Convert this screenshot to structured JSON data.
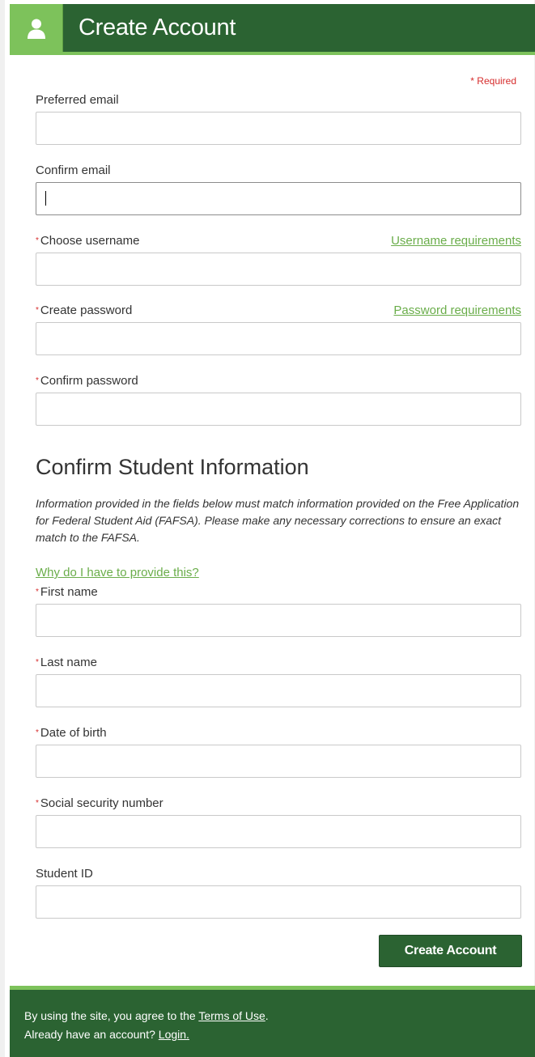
{
  "header": {
    "title": "Create Account",
    "icon": "user-icon"
  },
  "required_note": "* Required",
  "account_fields": [
    {
      "label": "Preferred email",
      "required": false,
      "value": "",
      "link": ""
    },
    {
      "label": "Confirm email",
      "required": false,
      "value": "",
      "link": ""
    },
    {
      "label": "Choose username",
      "required": true,
      "value": "",
      "link": "Username requirements"
    },
    {
      "label": "Create password",
      "required": true,
      "value": "",
      "link": "Password requirements"
    },
    {
      "label": "Confirm password",
      "required": true,
      "value": "",
      "link": ""
    }
  ],
  "student_section": {
    "title": "Confirm Student Information",
    "description": "Information provided in the fields below must match information provided on the Free Application for Federal Student Aid (FAFSA). Please make any necessary corrections to ensure an exact match to the FAFSA.",
    "why_link": "Why do I have to provide this?"
  },
  "student_fields": [
    {
      "label": "First name",
      "required": true,
      "value": ""
    },
    {
      "label": "Last name",
      "required": true,
      "value": ""
    },
    {
      "label": "Date of birth",
      "required": true,
      "value": ""
    },
    {
      "label": "Social security number",
      "required": true,
      "value": ""
    },
    {
      "label": "Student ID",
      "required": false,
      "value": ""
    }
  ],
  "submit_label": "Create Account",
  "footer": {
    "terms_prefix": "By using the site, you agree to the ",
    "terms_link": "Terms of Use",
    "terms_suffix": ".",
    "login_prefix": "Already have an account? ",
    "login_link": "Login."
  },
  "colors": {
    "header_green": "#2b6332",
    "accent_green": "#7dc25b",
    "link_green": "#6aad4a",
    "required_red": "#d62c2c"
  }
}
